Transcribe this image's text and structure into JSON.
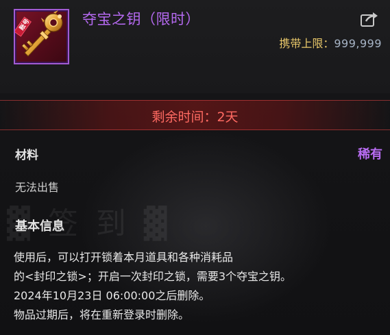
{
  "item": {
    "name": "夺宝之钥（限时）",
    "icon": "golden-key-icon",
    "icon_badge": "账号",
    "rarity_color": "#b569f0"
  },
  "carry": {
    "label": "携带上限：",
    "value": "999,999"
  },
  "timer": {
    "text": "剩余时间：2天",
    "color": "#ff6a62"
  },
  "meta": {
    "type": "材料",
    "rarity": "稀有",
    "sell": "无法出售"
  },
  "info": {
    "title": "基本信息",
    "lines": [
      "使用后，可以打开锁着本月道具和各种消耗品",
      "的<封印之锁>；开启一次封印之锁，需要3个夺宝之钥。",
      "2024年10月23日 06:00:00之后删除。",
      "物品过期后，将在重新登录时删除。"
    ]
  },
  "share": {
    "icon": "share-icon"
  }
}
